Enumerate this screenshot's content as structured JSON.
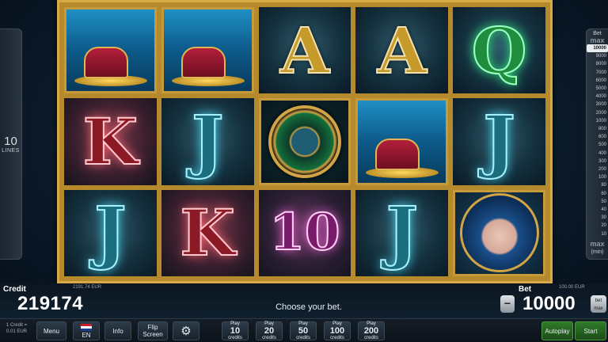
{
  "left_panel": {
    "lines_value": "10",
    "lines_label": "LINES"
  },
  "reels": [
    [
      {
        "type": "chest",
        "symbol": "treasure-chest"
      },
      {
        "type": "letter",
        "value": "K",
        "style": "red"
      },
      {
        "type": "letter",
        "value": "J",
        "style": "cyan"
      }
    ],
    [
      {
        "type": "chest",
        "symbol": "treasure-chest"
      },
      {
        "type": "letter",
        "value": "J",
        "style": "cyan"
      },
      {
        "type": "letter",
        "value": "K",
        "style": "red"
      }
    ],
    [
      {
        "type": "letter",
        "value": "A",
        "style": "gold"
      },
      {
        "type": "scatter",
        "symbol": "emerald-wheel"
      },
      {
        "type": "letter",
        "value": "10",
        "style": "pink"
      }
    ],
    [
      {
        "type": "letter",
        "value": "A",
        "style": "gold"
      },
      {
        "type": "chest",
        "symbol": "treasure-chest"
      },
      {
        "type": "letter",
        "value": "J",
        "style": "cyan"
      }
    ],
    [
      {
        "type": "letter",
        "value": "Q",
        "style": "green"
      },
      {
        "type": "letter",
        "value": "J",
        "style": "cyan"
      },
      {
        "type": "portrait",
        "symbol": "mermaid-portrait"
      }
    ]
  ],
  "bet_panel": {
    "title": "Bet",
    "max_label": "max",
    "min_label": "(min)",
    "options": [
      "10000",
      "9000",
      "8000",
      "7000",
      "6000",
      "5000",
      "4000",
      "3000",
      "2000",
      "1000",
      "800",
      "600",
      "500",
      "400",
      "300",
      "200",
      "100",
      "80",
      "60",
      "50",
      "40",
      "30",
      "20",
      "10"
    ],
    "selected": "10000"
  },
  "info": {
    "credit_label": "Credit",
    "credit_sub": "2191.74 EUR",
    "credit_value": "219174",
    "message": "Choose your bet.",
    "bet_label": "Bet",
    "bet_sub": "100.00 EUR",
    "bet_value": "10000",
    "minus_label": "−",
    "max_line1": "bet",
    "max_line2": "max"
  },
  "controls": {
    "rate_line1": "1 Credit =",
    "rate_line2": "0.01 EUR",
    "menu": "Menu",
    "lang": "EN",
    "info": "Info",
    "flip_line1": "Flip",
    "flip_line2": "Screen",
    "settings_icon": "gear-icon",
    "play_label": "Play",
    "credits_label": "credits",
    "play_options": [
      "10",
      "20",
      "50",
      "100",
      "200"
    ],
    "autoplay": "Autoplay",
    "start": "Start"
  }
}
